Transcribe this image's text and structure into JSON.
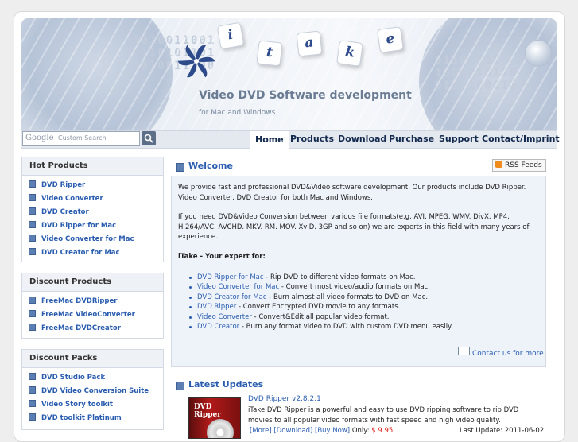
{
  "header": {
    "logo_letters": [
      "i",
      "t",
      "a",
      "k",
      "e"
    ],
    "title": "Video DVD Software development",
    "subtitle": "for Mac and Windows",
    "binary_text": [
      "1010011001",
      "0110101101",
      "1010011100",
      "01101011",
      "1001010110",
      "0110100011"
    ]
  },
  "search": {
    "brand": "Google",
    "placeholder": "Custom Search"
  },
  "nav": [
    "Home",
    "Products",
    "Download",
    "Purchase",
    "Support",
    "Contact/Imprint"
  ],
  "sidebar": [
    {
      "title": "Hot Products",
      "items": [
        "DVD Ripper",
        "Video Converter",
        "DVD Creator",
        "DVD Ripper for Mac",
        "Video Converter for Mac",
        "DVD Creator for Mac"
      ]
    },
    {
      "title": "Discount Products",
      "items": [
        "FreeMac DVDRipper",
        "FreeMac VideoConverter",
        "FreeMac DVDCreator"
      ]
    },
    {
      "title": "Discount Packs",
      "items": [
        "DVD Studio Pack",
        "DVD Video Conversion Suite",
        "Video Story toolkit",
        "DVD toolkit Platinum"
      ]
    }
  ],
  "welcome": {
    "title": "Welcome",
    "rss": "RSS Feeds",
    "para1": "We provide fast and professional DVD&Video software development. Our products include DVD Ripper. Video Converter. DVD Creator for both Mac and Windows.",
    "para2": "If you need DVD&Video Conversion between various file formats(e.g. AVI. MPEG. WMV. DivX. MP4. H.264/AVC. AVCHD. MKV. RM. MOV. XviD. 3GP and so on) we are experts in this field with many years of experience.",
    "expert": "iTake - Your expert for:",
    "bullets": [
      {
        "link": "DVD Ripper for Mac",
        "text": " - Rip DVD to different video formats on Mac."
      },
      {
        "link": "Video Converter for Mac",
        "text": " - Convert most video/audio formats on Mac."
      },
      {
        "link": "DVD Creator for Mac",
        "text": " - Burn almost all video formats to DVD on Mac."
      },
      {
        "link": "DVD Ripper",
        "text": " - Convert Encrypted DVD movie to any formats."
      },
      {
        "link": "Video Converter",
        "text": " - Convert&Edit all popular video format."
      },
      {
        "link": "DVD Creator",
        "text": " - Burn any format video to DVD with custom DVD menu easily."
      }
    ],
    "contact": "Contact us for more."
  },
  "updates": {
    "title": "Latest Updates",
    "product_title": "DVD Ripper v2.8.2.1",
    "box_label": "DVD Ripper",
    "desc": "iTake DVD Ripper is a powerful and easy to use DVD ripping software to rip DVD movies to all popular video formats with fast speed and high video quality.",
    "links": [
      "[More]",
      "[Download]",
      "[Buy Now]"
    ],
    "only_label": "Only:",
    "price": "$ 9.95",
    "last_update": "Last Update: 2011-06-02"
  },
  "colors": {
    "link": "#2a5db0",
    "nav": "#12294d",
    "price": "#e0201a"
  }
}
